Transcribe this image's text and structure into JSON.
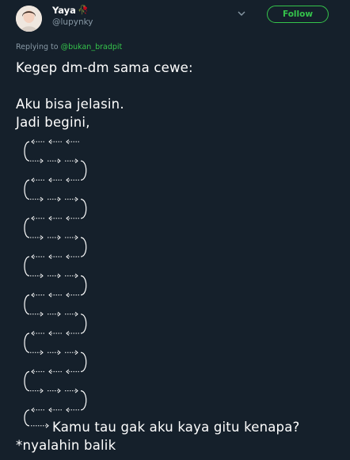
{
  "author": {
    "display_name": "Yaya",
    "name_emoji": "🥀",
    "handle": "@lupynky",
    "avatar": "avatar-photo"
  },
  "follow_label": "Follow",
  "reply": {
    "prefix": "Replying to",
    "target": "@bukan_bradpit"
  },
  "body": {
    "line1": "Kegep dm-dm sama cewe:",
    "line2": "Aku bisa jelasin.",
    "line3": "Jadi begini,",
    "closing": "Kamu tau gak aku kaya gitu kenapa?",
    "footer": "*nyalahin balik"
  },
  "colors": {
    "background": "#15202b",
    "accent": "#35c44b",
    "muted": "#8899a6",
    "text": "#ffffff"
  },
  "icons": [
    "chevron-down-icon",
    "left-arrow-icon",
    "right-arrow-icon",
    "curve-arrow-icon"
  ]
}
